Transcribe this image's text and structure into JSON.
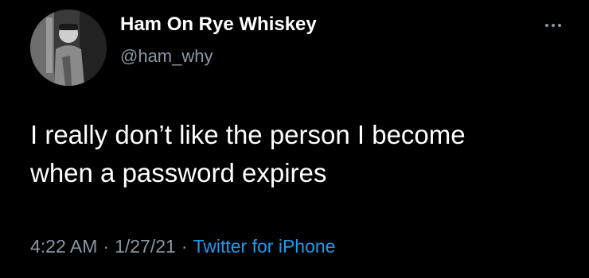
{
  "user": {
    "display_name": "Ham On Rye Whiskey",
    "handle": "@ham_why",
    "avatar_icon": "profile-photo"
  },
  "tweet": {
    "text_lines": [
      "I really don’t like the person I become",
      "when a password expires"
    ],
    "time": "4:22 AM",
    "date": "1/27/21",
    "separator": "·",
    "source": "Twitter for iPhone"
  },
  "actions": {
    "more_icon": "more-options-icon"
  },
  "colors": {
    "background": "#000000",
    "primary_text": "#ffffff",
    "secondary_text": "#8b98a5",
    "link": "#1d9bf0"
  }
}
